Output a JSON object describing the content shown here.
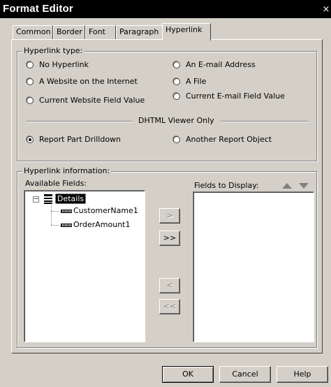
{
  "window": {
    "title": "Format Editor",
    "close_glyph": "×"
  },
  "tabs": [
    {
      "label": "Common"
    },
    {
      "label": "Border"
    },
    {
      "label": "Font"
    },
    {
      "label": "Paragraph"
    },
    {
      "label": "Hyperlink"
    }
  ],
  "hyperlink_type": {
    "title": "Hyperlink type:",
    "options": {
      "no_hyperlink": "No Hyperlink",
      "website": "A Website on the Internet",
      "current_website_field": "Current Website Field Value",
      "email_address": "An E-mail Address",
      "file": "A File",
      "current_email_field": "Current E-mail Field Value"
    },
    "dhtml_label": "DHTML Viewer Only",
    "dhtml_options": {
      "report_part_drilldown": "Report Part Drilldown",
      "another_report_object": "Another Report Object"
    },
    "selected": "report_part_drilldown"
  },
  "hyperlink_information": {
    "title": "Hyperlink information:",
    "available_fields_label": "Available Fields:",
    "fields_to_display_label": "Fields to Display:",
    "tree": {
      "root": "Details",
      "children": [
        "CustomerName1",
        "OrderAmount1"
      ]
    },
    "move_buttons": {
      "add_one": ">",
      "add_all": ">>",
      "remove_one": "<",
      "remove_all": "<<"
    }
  },
  "footer": {
    "ok": "OK",
    "cancel": "Cancel",
    "help": "Help"
  }
}
